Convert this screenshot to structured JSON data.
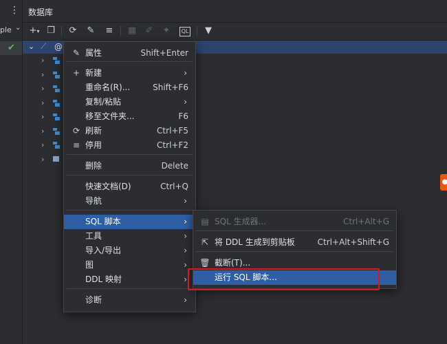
{
  "left_strip": {
    "menu_dots": "⋮",
    "partial_text": "ple",
    "chevron": "⌄",
    "checkmark": "✔"
  },
  "tool_window": {
    "title": "数据库"
  },
  "toolbar": {
    "icons": [
      "add-icon",
      "copy-icon",
      "refresh-icon",
      "properties-icon",
      "disable-datasource-icon",
      "table-icon",
      "edit-icon",
      "jump-icon",
      "sql-icon",
      "filter-icon"
    ]
  },
  "tree": {
    "root_label": "@",
    "expand_glyph": "›",
    "collapse_glyph": "⌄",
    "child_count": 8
  },
  "context_menu": {
    "items": [
      {
        "label": "属性",
        "shortcut": "Shift+Enter",
        "icon": "✎"
      },
      {
        "label": "新建",
        "icon": "+",
        "arrow": "›"
      },
      {
        "label": "重命名(R)...",
        "shortcut": "Shift+F6"
      },
      {
        "label": "复制/粘贴",
        "arrow": "›"
      },
      {
        "label": "移至文件夹...",
        "shortcut": "F6"
      },
      {
        "label": "刷新",
        "shortcut": "Ctrl+F5",
        "icon": "⟳"
      },
      {
        "label": "停用",
        "shortcut": "Ctrl+F2",
        "icon": "≡"
      },
      {
        "label": "删除",
        "shortcut": "Delete"
      },
      {
        "label": "快速文档(D)",
        "shortcut": "Ctrl+Q"
      },
      {
        "label": "导航",
        "arrow": "›"
      },
      {
        "label": "SQL 脚本",
        "arrow": "›"
      },
      {
        "label": "工具",
        "arrow": "›"
      },
      {
        "label": "导入/导出",
        "arrow": "›"
      },
      {
        "label": "图",
        "arrow": "›"
      },
      {
        "label": "DDL 映射",
        "arrow": "›"
      },
      {
        "label": "诊断",
        "arrow": "›"
      }
    ]
  },
  "submenu": {
    "items": [
      {
        "label": "SQL 生成器...",
        "shortcut": "Ctrl+Alt+G",
        "icon": "▤"
      },
      {
        "label": "将 DDL 生成到剪贴板",
        "shortcut": "Ctrl+Alt+Shift+G",
        "icon": "⇱"
      },
      {
        "label": "截断(T)...",
        "icon": "🗑"
      },
      {
        "label": "运行 SQL 脚本..."
      }
    ]
  },
  "colors": {
    "highlight": "#2e5fa6",
    "annotation_box": "#e0161e",
    "selected_row": "#2e436e"
  }
}
